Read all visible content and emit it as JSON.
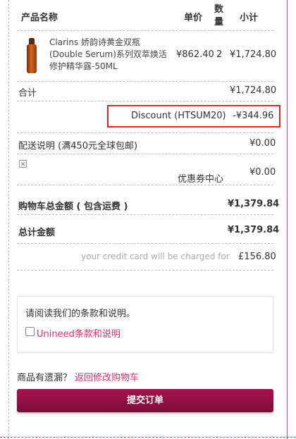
{
  "table": {
    "headers": {
      "name": "产品名称",
      "price": "单价",
      "qty": "数量",
      "subtotal": "小计"
    },
    "product": {
      "name": "Clarins 娇韵诗黄金双瓶(Double Serum)系列双萃焕活修护精华露-50ML",
      "price": "¥862.40",
      "qty": "2",
      "subtotal": "¥1,724.80"
    }
  },
  "summary": {
    "subtotal_label": "合计",
    "subtotal_value": "¥1,724.80",
    "discount_label": "Discount (HTSUM20)",
    "discount_value": "-¥344.96",
    "shipping_label": "配送说明 (满450元全球包邮)",
    "shipping_value": "¥0.00",
    "coupon_label": "优惠券中心",
    "coupon_value": "¥0.00",
    "cart_total_label": "购物车总金额 ( 包含运费 )",
    "cart_total_value": "¥1,379.84",
    "grand_total_label": "总计金额",
    "grand_total_value": "¥1,379.84",
    "charge_label": "your credit card will be charged for",
    "charge_value": "£156.80"
  },
  "terms": {
    "prompt": "请阅读我们的条款和说明。",
    "checkbox_label": "Unineed条款和说明"
  },
  "footer": {
    "missing_text": "商品有遗漏？",
    "back_link": "返回修改购物车",
    "submit_label": "提交订单"
  }
}
